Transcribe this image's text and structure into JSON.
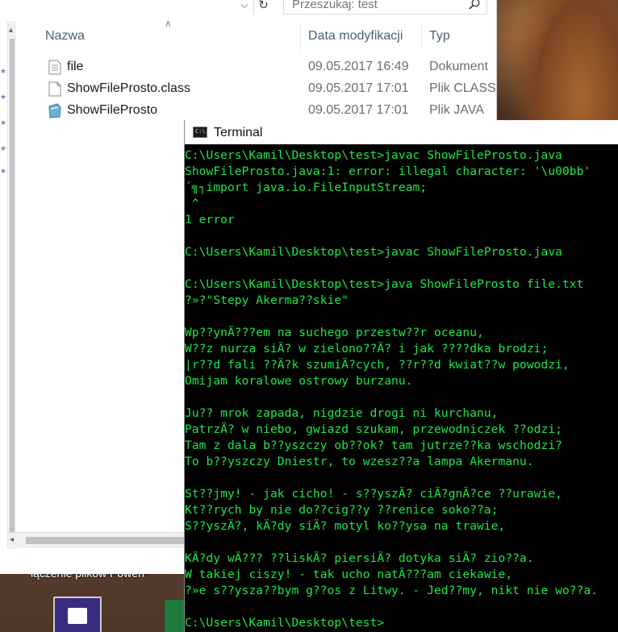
{
  "desktop": {
    "label": "łączenie plików  PowerP"
  },
  "explorer": {
    "search": {
      "placeholder": "Przeszukaj: test"
    },
    "columns": {
      "name": "Nazwa",
      "modified": "Data modyfikacji",
      "type": "Typ"
    },
    "files": [
      {
        "name": "file",
        "modified": "09.05.2017 16:49",
        "type": "Dokument",
        "icon": "text-document-icon"
      },
      {
        "name": "ShowFileProsto.class",
        "modified": "09.05.2017 17:01",
        "type": "Plik CLASS",
        "icon": "blank-file-icon"
      },
      {
        "name": "ShowFileProsto",
        "modified": "09.05.2017 17:01",
        "type": "Plik JAVA",
        "icon": "java-file-icon"
      }
    ]
  },
  "terminal": {
    "title": "Terminal",
    "text_color": "#1ee84a",
    "lines": [
      "C:\\Users\\Kamil\\Desktop\\test>javac ShowFileProsto.java",
      "ShowFileProsto.java:1: error: illegal character: '\\u00bb'",
      "´╗┐import java.io.FileInputStream;",
      " ^",
      "1 error",
      "",
      "C:\\Users\\Kamil\\Desktop\\test>javac ShowFileProsto.java",
      "",
      "C:\\Users\\Kamil\\Desktop\\test>java ShowFileProsto file.txt",
      "?»?\"Stepy Akerma??skie\"",
      "",
      "Wp??ynÄ???em na suchego przestw??r oceanu,",
      "W??z nurza siÄ? w zielono??Ä? i jak ????dka brodzi;",
      "|r??d fali ??Ä?k szumiÄ?cych, ??r??d kwiat??w powodzi,",
      "Omijam koralowe ostrowy burzanu.",
      "",
      "Ju?? mrok zapada, nigdzie drogi ni kurchanu,",
      "PatrzÄ? w niebo, gwiazd szukam, przewodniczek ??odzi;",
      "Tam z dala b??yszczy ob??ok? tam jutrze??ka wschodzi?",
      "To b??yszczy Dniestr, to wzesz??a lampa Akermanu.",
      "",
      "St??jmy! - jak cicho! - s??yszÄ? ciÄ?gnÄ?ce ??urawie,",
      "Kt??rych by nie do??cig??y ??renice soko??a;",
      "S??yszÄ?, kÄ?dy siÄ? motyl ko??ysa na trawie,",
      "",
      "KÄ?dy wÄ??? ??liskÄ? piersiÄ? dotyka siÄ? zio??a.",
      "W takiej ciszy! - tak ucho natÄ???am ciekawie,",
      "?»e s??ysza??bym g??os z Litwy. - Jed??my, nikt nie wo??a.",
      "",
      "C:\\Users\\Kamil\\Desktop\\test>"
    ]
  }
}
